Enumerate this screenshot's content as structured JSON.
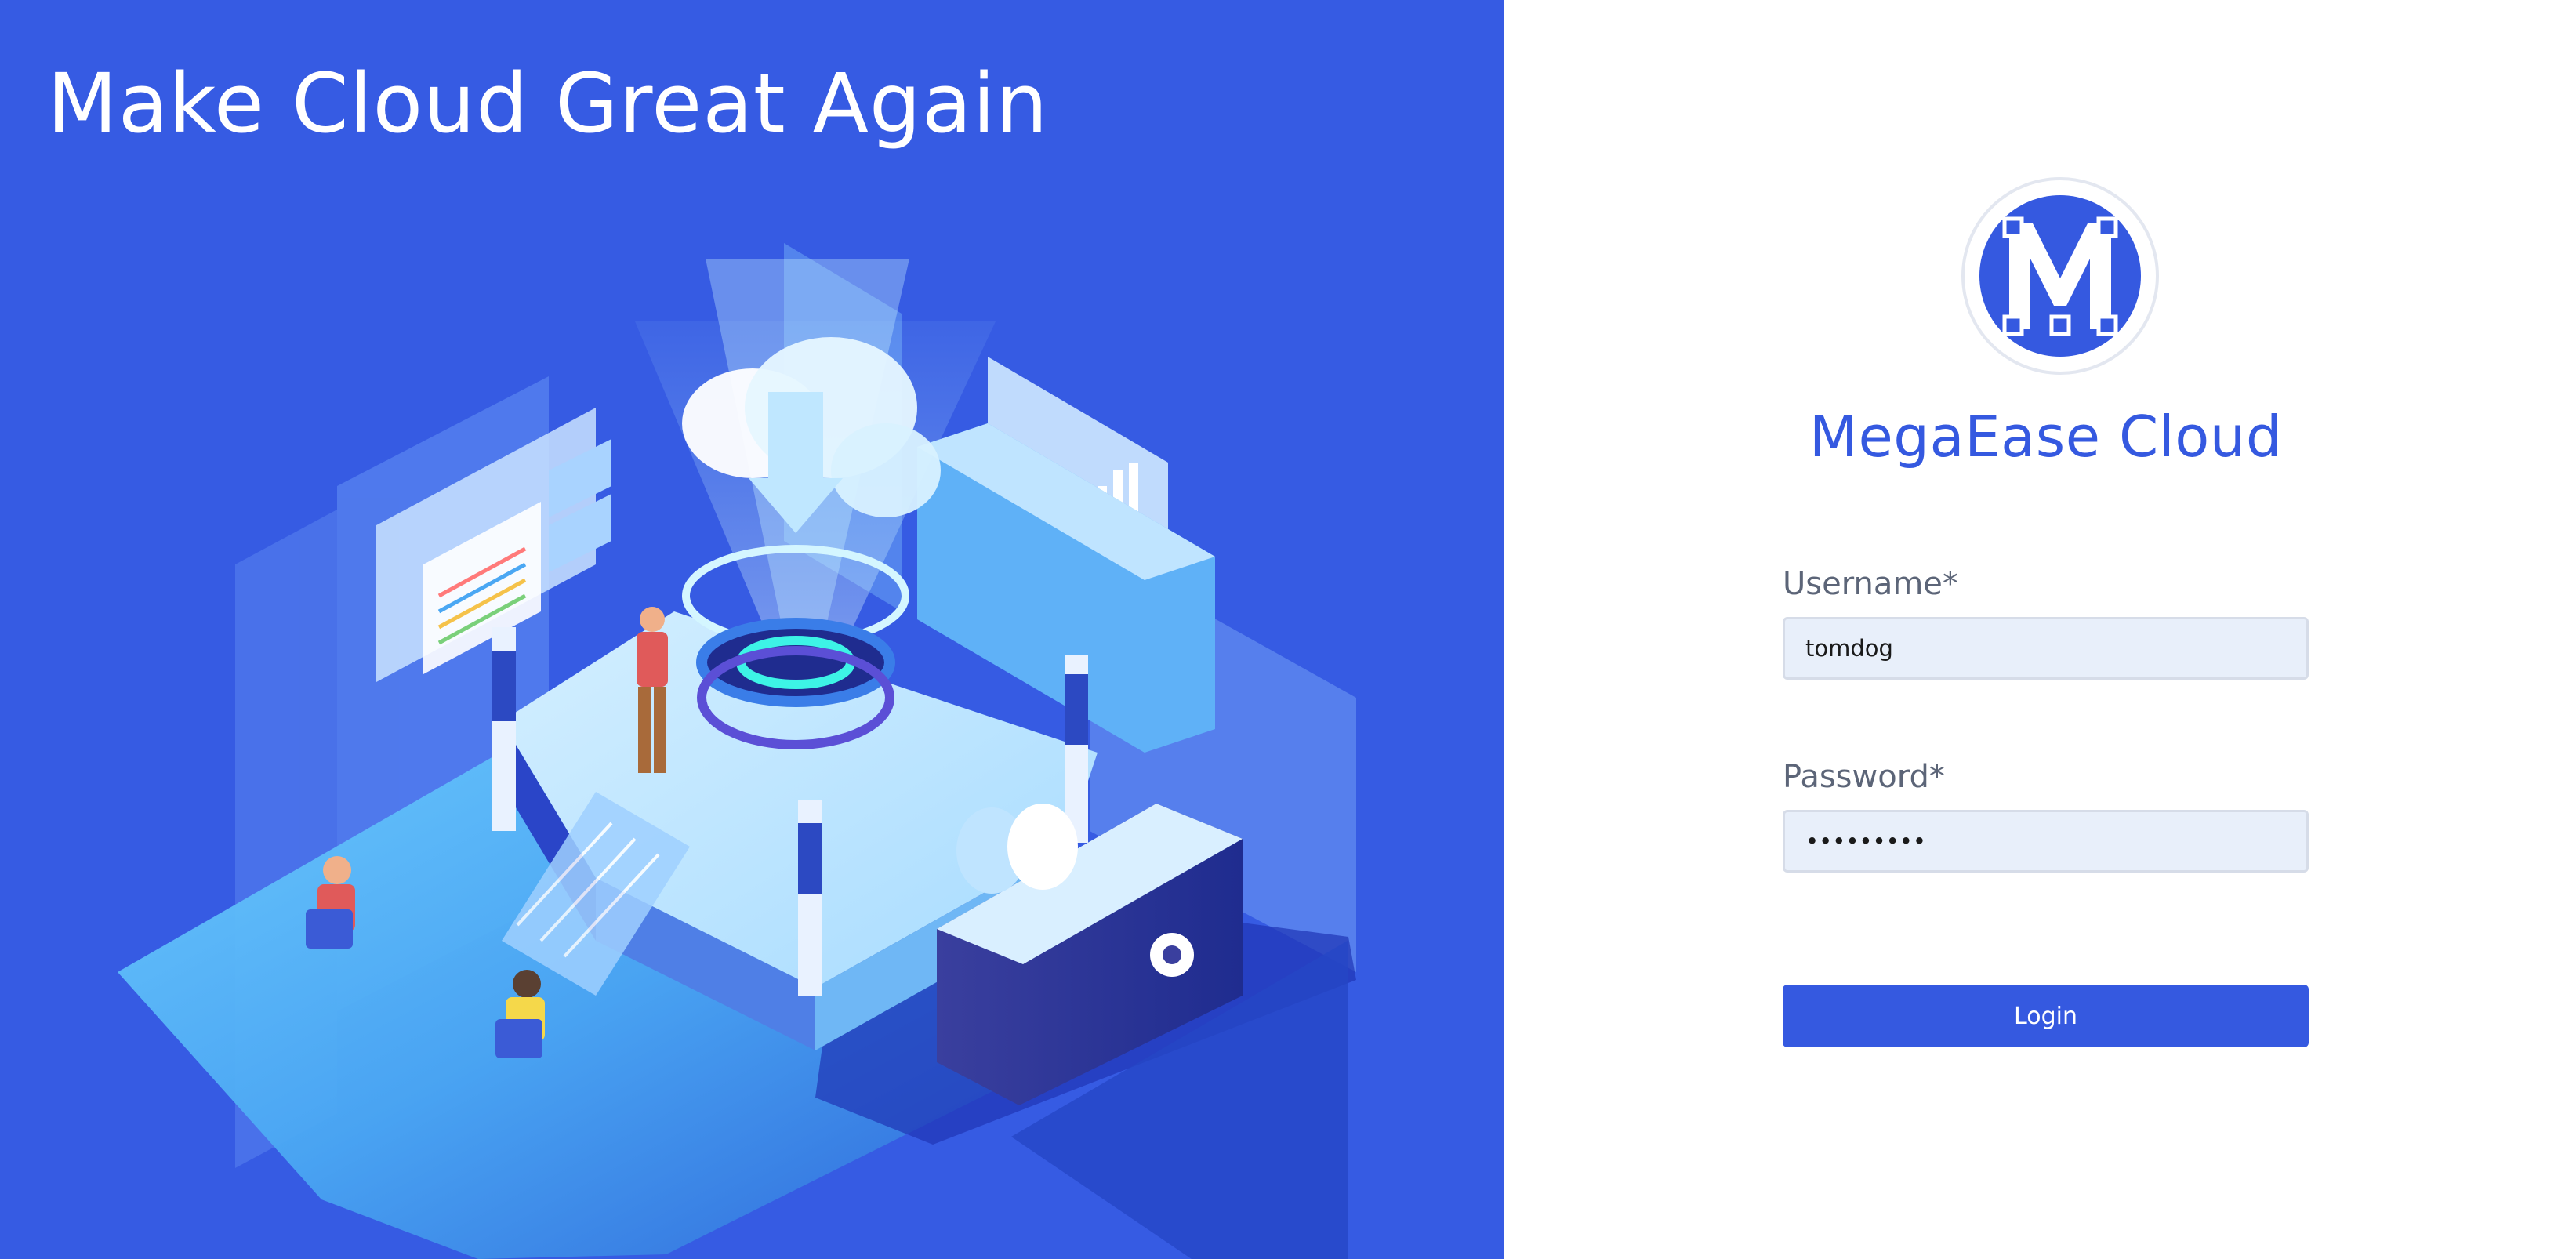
{
  "hero": {
    "title": "Make Cloud Great Again",
    "background_color": "#365be3"
  },
  "login": {
    "brand_name": "MegaEase Cloud",
    "logo_letter": "M",
    "logo_icon": "megaease-logo-icon",
    "username_label": "Username*",
    "username_value": "tomdog",
    "password_label": "Password*",
    "password_value": "•••••••••",
    "login_button_label": "Login",
    "accent_color": "#3559e0",
    "input_background": "#e8effa"
  }
}
